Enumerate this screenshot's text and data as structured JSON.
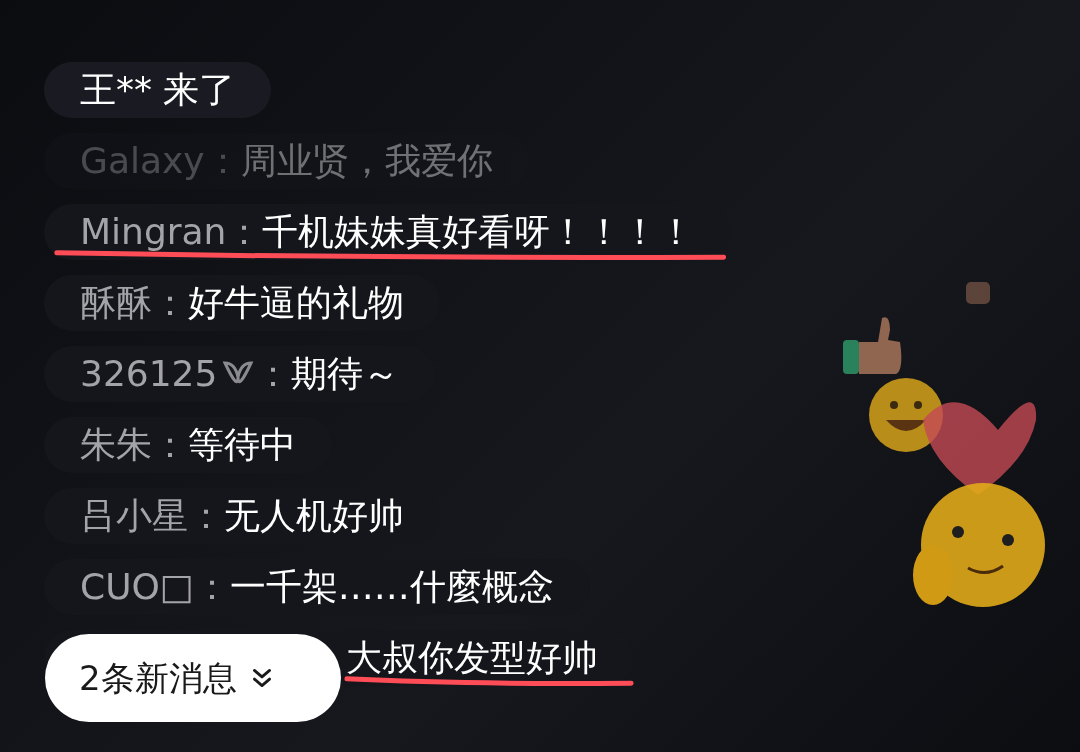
{
  "messages": [
    {
      "kind": "system",
      "text": "王** 来了",
      "faded": false,
      "underlined": false
    },
    {
      "kind": "chat",
      "name": "Galaxy",
      "colon": "：",
      "text": "周业贤，我爱你",
      "faded": true,
      "underlined": false
    },
    {
      "kind": "chat",
      "name": "Mingran",
      "colon": "：",
      "text": "千机妹妹真好看呀！！！！",
      "faded": false,
      "underlined": true
    },
    {
      "kind": "chat",
      "name": "酥酥",
      "colon": "：",
      "text": "好牛逼的礼物",
      "faded": false,
      "underlined": false
    },
    {
      "kind": "chat",
      "name": "326125",
      "badge": true,
      "colon": "：",
      "text": "期待～",
      "faded": false,
      "underlined": false
    },
    {
      "kind": "chat",
      "name": "朱朱",
      "colon": "：",
      "text": "等待中",
      "faded": false,
      "underlined": false
    },
    {
      "kind": "chat",
      "name": "吕小星",
      "colon": "：",
      "text": "无人机好帅",
      "faded": false,
      "underlined": false
    },
    {
      "kind": "chat",
      "name": "CUO□",
      "colon": "：",
      "text": "一千架……什麼概念",
      "faded": false,
      "underlined": false
    },
    {
      "kind": "covered",
      "text": "大叔你发型好帅",
      "faded": false,
      "underlined": true
    }
  ],
  "new_messages_button": {
    "label": "2条新消息"
  }
}
